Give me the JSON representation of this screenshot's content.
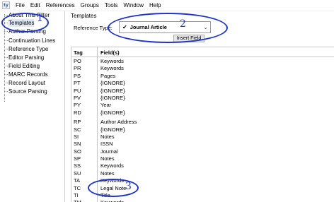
{
  "app_icon_text": "ty",
  "menu": [
    "File",
    "Edit",
    "References",
    "Groups",
    "Tools",
    "Window",
    "Help"
  ],
  "sidebar": {
    "items": [
      {
        "label": "About This Filter"
      },
      {
        "label": "Templates"
      },
      {
        "label": "Author Parsing"
      },
      {
        "label": "Continuation Lines"
      },
      {
        "label": "Reference Type"
      },
      {
        "label": "Editor Parsing"
      },
      {
        "label": "Field Editing"
      },
      {
        "label": "MARC Records"
      },
      {
        "label": "Record Layout"
      },
      {
        "label": "Source Parsing"
      }
    ]
  },
  "templates": {
    "group_title": "Templates",
    "ref_type_label": "Reference Type:",
    "selected_type": "Journal Article",
    "check_icon": "check-icon",
    "insert_field_label": "Insert Field"
  },
  "table": {
    "headers": [
      "Tag",
      "Field(s)"
    ],
    "rows": [
      {
        "tag": "PO",
        "field": "Keywords"
      },
      {
        "tag": "PR",
        "field": "Keywords"
      },
      {
        "tag": "PS",
        "field": "Pages"
      },
      {
        "tag": "PT",
        "field": "{IGNORE}"
      },
      {
        "tag": "PU",
        "field": "{IGNORE}"
      },
      {
        "tag": "PV",
        "field": "{IGNORE}"
      },
      {
        "tag": "PY",
        "field": "Year"
      },
      {
        "tag": "RD",
        "field": "{IGNORE}"
      },
      {
        "tag": "RP",
        "field": "Author Address"
      },
      {
        "tag": "SC",
        "field": "{IGNORE}"
      },
      {
        "tag": "SI",
        "field": "Notes"
      },
      {
        "tag": "SN",
        "field": "ISSN"
      },
      {
        "tag": "SO",
        "field": "Journal"
      },
      {
        "tag": "SP",
        "field": "Notes"
      },
      {
        "tag": "SS",
        "field": "Keywords"
      },
      {
        "tag": "SU",
        "field": "Notes"
      },
      {
        "tag": "TA",
        "field": "Keywords"
      },
      {
        "tag": "TC",
        "field": "Legal Note"
      },
      {
        "tag": "TI",
        "field": "Title"
      },
      {
        "tag": "TM",
        "field": "Keywords"
      }
    ]
  },
  "annotations": {
    "one": "1",
    "two": "2",
    "three": "3",
    "color": "#1f35c8"
  }
}
